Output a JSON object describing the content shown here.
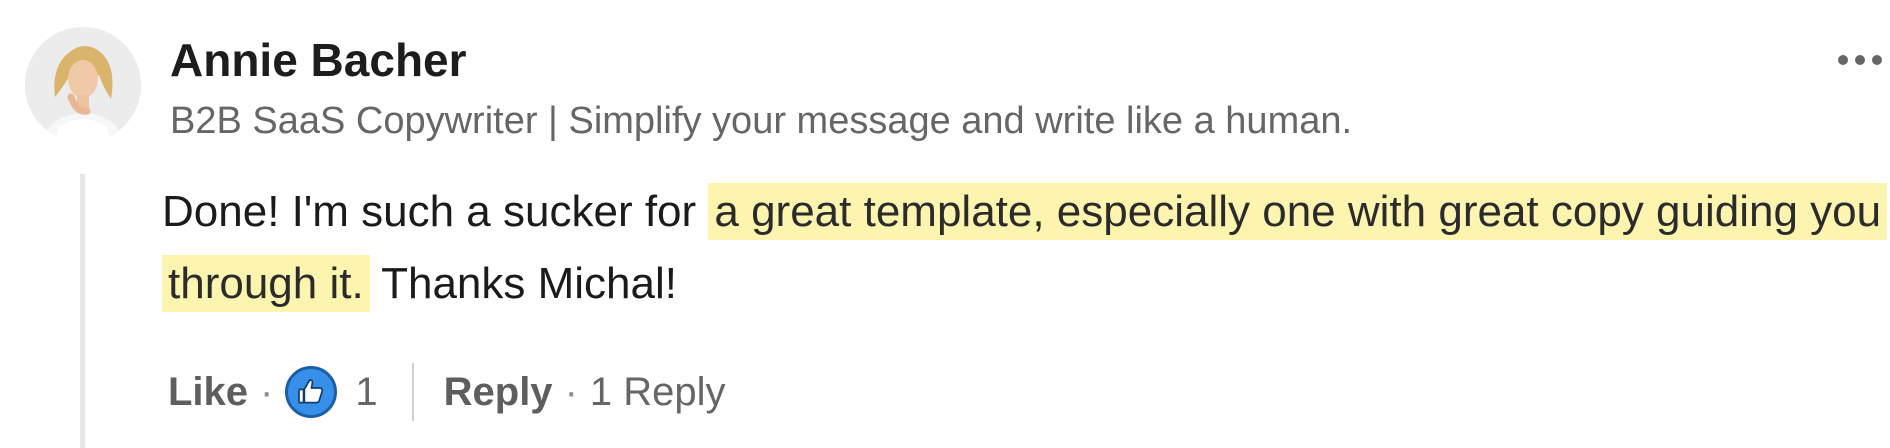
{
  "author": {
    "name": "Annie Bacher",
    "headline": "B2B SaaS Copywriter | Simplify your message and write like a human."
  },
  "more_icon": "ellipsis-icon",
  "comment": {
    "text_before": "Done! I'm such a sucker for ",
    "highlighted": "a great template, especially one with great copy guiding you through it.",
    "text_after": " Thanks Michal!"
  },
  "actions": {
    "like_label": "Like",
    "separator": "·",
    "reaction_icon": "thumbs-up-icon",
    "like_count": "1",
    "reply_label": "Reply",
    "reply_count_label": "1 Reply"
  },
  "colors": {
    "highlight": "#fdf4b0",
    "like_blue": "#378fe9",
    "muted_text": "#666666"
  }
}
